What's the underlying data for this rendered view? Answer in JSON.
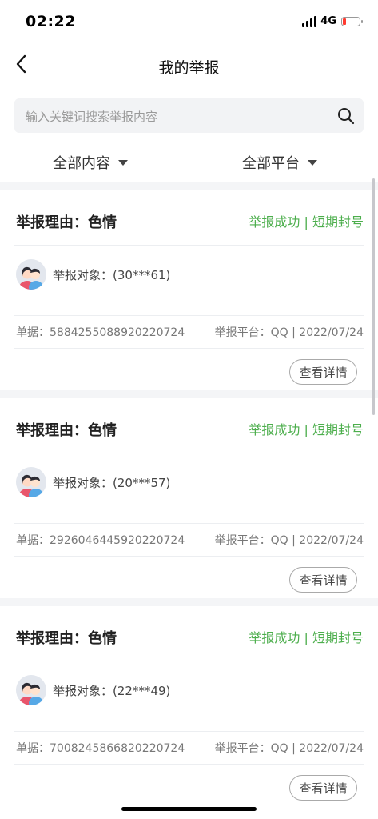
{
  "status_bar": {
    "time": "02:22",
    "network": "4G"
  },
  "nav": {
    "title": "我的举报"
  },
  "search": {
    "placeholder": "输入关键词搜索举报内容"
  },
  "filters": {
    "content": "全部内容",
    "platform": "全部平台"
  },
  "reports": [
    {
      "reason": "举报理由：色情",
      "status": "举报成功 | 短期封号",
      "target": "举报对象：(30***61)",
      "order": "单据：5884255088920220724",
      "platform": "举报平台：QQ | 2022/07/24",
      "detail_label": "查看详情"
    },
    {
      "reason": "举报理由：色情",
      "status": "举报成功 | 短期封号",
      "target": "举报对象：(20***57)",
      "order": "单据：2926046445920220724",
      "platform": "举报平台：QQ | 2022/07/24",
      "detail_label": "查看详情"
    },
    {
      "reason": "举报理由：色情",
      "status": "举报成功 | 短期封号",
      "target": "举报对象：(22***49)",
      "order": "单据：7008245866820220724",
      "platform": "举报平台：QQ | 2022/07/24",
      "detail_label": "查看详情"
    }
  ],
  "colors": {
    "success": "#4cae4c",
    "background_gap": "#f4f5f7",
    "search_bg": "#f2f3f5"
  },
  "icons": [
    "back-icon",
    "search-icon",
    "caret-down-icon",
    "avatar-icon",
    "signal-icon",
    "battery-icon"
  ]
}
